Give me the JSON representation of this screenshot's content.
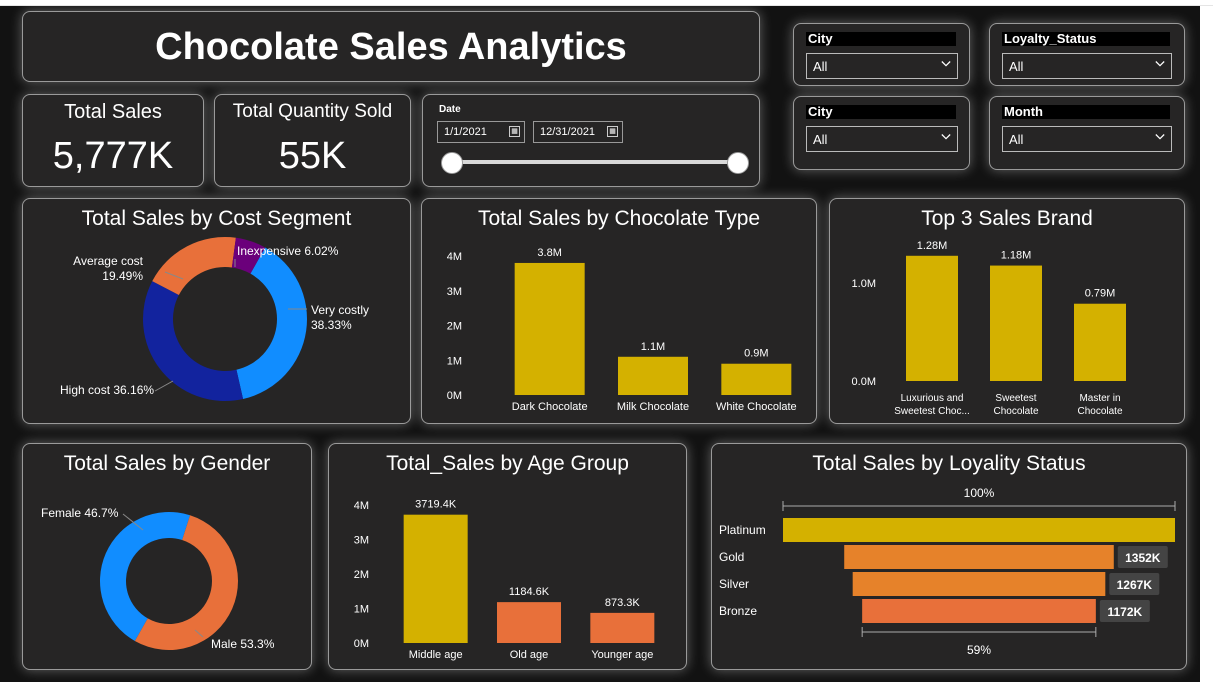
{
  "title": "Chocolate Sales Analytics",
  "kpis": {
    "total_sales_label": "Total Sales",
    "total_sales_value": "5,777K",
    "quantity_label": "Total Quantity Sold",
    "quantity_value": "55K"
  },
  "date_slicer": {
    "label": "Date",
    "start": "1/1/2021",
    "end": "12/31/2021",
    "range": [
      0,
      1
    ]
  },
  "slicers": [
    {
      "label": "City",
      "value": "All"
    },
    {
      "label": "Loyalty_Status",
      "value": "All"
    },
    {
      "label": "City",
      "value": "All"
    },
    {
      "label": "Month",
      "value": "All"
    }
  ],
  "colors": {
    "yellow": "#d4b100",
    "orange": "#e8703a",
    "orange2": "#e6822a",
    "blue": "#118dff",
    "navy": "#12239e",
    "purple": "#6b007b",
    "card_bg": "#262525",
    "panel_bg": "#121212"
  },
  "chart_data": [
    {
      "id": "cost_segment",
      "type": "pie",
      "title": "Total Sales by Cost Segment",
      "slices": [
        {
          "name": "Very costly",
          "value": 38.33,
          "label": "Very costly\n38.33%"
        },
        {
          "name": "High cost",
          "value": 36.16,
          "label": "High cost 36.16%"
        },
        {
          "name": "Average cost",
          "value": 19.49,
          "label": "Average cost\n19.49%"
        },
        {
          "name": "Inexpensive",
          "value": 6.02,
          "label": "Inexpensive 6.02%"
        }
      ]
    },
    {
      "id": "chocolate_type",
      "type": "bar",
      "title": "Total Sales by Chocolate Type",
      "categories": [
        "Dark Chocolate",
        "Milk Chocolate",
        "White Chocolate"
      ],
      "values": [
        3.8,
        1.1,
        0.9
      ],
      "data_labels": [
        "3.8M",
        "1.1M",
        "0.9M"
      ],
      "yticks": [
        "0M",
        "1M",
        "2M",
        "3M",
        "4M"
      ],
      "ylim": [
        0,
        4
      ]
    },
    {
      "id": "top_brands",
      "type": "bar",
      "title": "Top 3 Sales Brand",
      "categories": [
        "Luxurious and Sweetest Choc...",
        "Sweetest Chocolate",
        "Master in Chocolate"
      ],
      "category_lines": [
        [
          "Luxurious and",
          "Sweetest Choc..."
        ],
        [
          "Sweetest",
          "Chocolate"
        ],
        [
          "Master in",
          "Chocolate"
        ]
      ],
      "values": [
        1.28,
        1.18,
        0.79
      ],
      "data_labels": [
        "1.28M",
        "1.18M",
        "0.79M"
      ],
      "yticks": [
        "0.0M",
        "1.0M"
      ],
      "ylim": [
        0,
        1.38
      ]
    },
    {
      "id": "gender",
      "type": "pie",
      "title": "Total Sales by Gender",
      "slices": [
        {
          "name": "Female",
          "value": 46.7,
          "label": "Female 46.7%"
        },
        {
          "name": "Male",
          "value": 53.3,
          "label": "Male 53.3%"
        }
      ]
    },
    {
      "id": "age_group",
      "type": "bar",
      "title": "Total_Sales by Age Group",
      "categories": [
        "Middle age",
        "Old age",
        "Younger age"
      ],
      "values": [
        3719.4,
        1184.6,
        873.3
      ],
      "data_labels": [
        "3719.4K",
        "1184.6K",
        "873.3K"
      ],
      "yticks": [
        "0M",
        "1M",
        "2M",
        "3M",
        "4M"
      ],
      "ylim": [
        0,
        4000
      ]
    },
    {
      "id": "loyalty",
      "type": "bar",
      "title": "Total Sales by Loyality Status",
      "categories": [
        "Platinum",
        "Gold",
        "Silver",
        "Bronze"
      ],
      "values": [
        1966,
        1352,
        1267,
        1172
      ],
      "data_labels": [
        "",
        "1352K",
        "1267K",
        "1172K"
      ],
      "top_label": "100%",
      "bottom_label": "59%"
    }
  ]
}
